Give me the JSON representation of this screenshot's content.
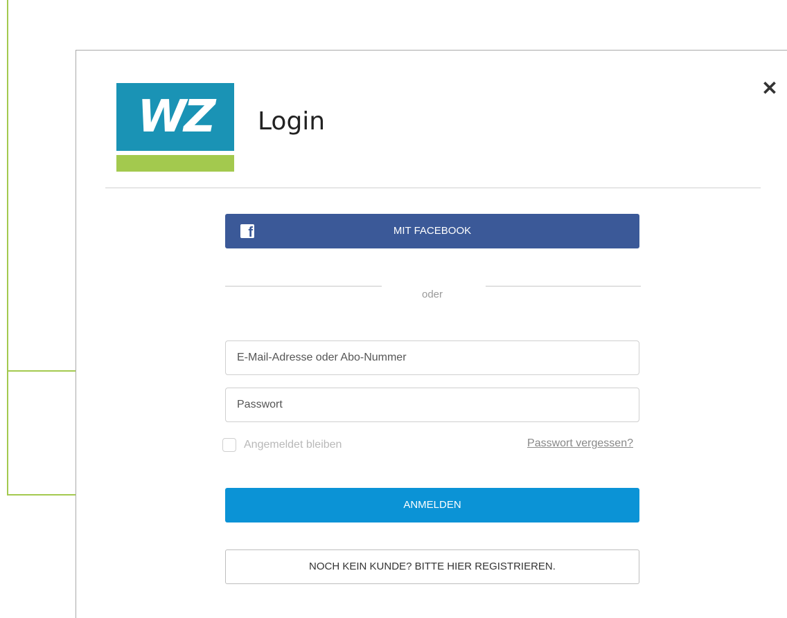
{
  "modal": {
    "title": "Login",
    "logo_text": "WZ",
    "close_label": "✕"
  },
  "social": {
    "facebook_label": "MIT FACEBOOK",
    "facebook_icon_glyph": "f"
  },
  "divider": {
    "or_label": "oder"
  },
  "form": {
    "email_placeholder": "E-Mail-Adresse oder Abo-Nummer",
    "email_value": "",
    "password_placeholder": "Passwort",
    "password_value": "",
    "remember_label": "Angemeldet bleiben",
    "remember_checked": false,
    "forgot_label": "Passwort vergessen?",
    "submit_label": "ANMELDEN",
    "register_label": "NOCH KEIN KUNDE? BITTE HIER REGISTRIEREN."
  },
  "colors": {
    "brand_blue": "#1a93b5",
    "brand_green": "#a3c94e",
    "facebook_blue": "#3b5998",
    "primary_button": "#0b93d6",
    "annotation_arrow": "#a3c94e"
  },
  "icons": {
    "close": "close-icon",
    "facebook": "facebook-icon"
  }
}
